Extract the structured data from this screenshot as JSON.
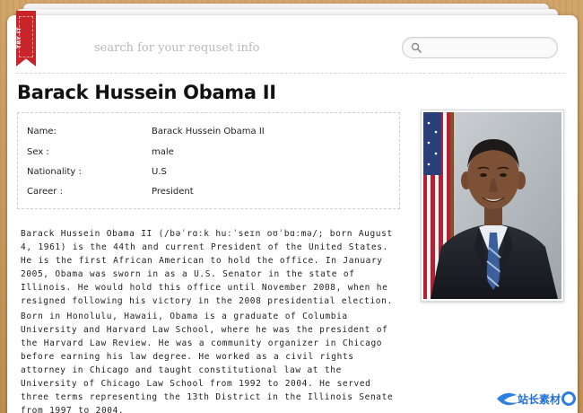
{
  "ribbon": {
    "label": "TRY IT"
  },
  "search": {
    "hint": "search for your requset info",
    "placeholder": "",
    "icon": "search-icon"
  },
  "profile": {
    "title": "Barack Hussein Obama II",
    "fields": [
      {
        "label": "Name:",
        "value": "Barack Hussein Obama II"
      },
      {
        "label": "Sex :",
        "value": "male"
      },
      {
        "label": "Nationality :",
        "value": "U.S"
      },
      {
        "label": "Career :",
        "value": "President"
      }
    ],
    "photo_alt": "portrait-photo"
  },
  "bio": {
    "paragraph1": "Barack Hussein Obama II (/bəˈrɑːk huːˈseɪn oʊˈbɑːmə/; born August 4, 1961) is the 44th and current President of the United States. He is the first African American to hold the office. In January 2005, Obama was sworn in as a U.S. Senator in the state of Illinois. He would hold this office until November 2008, when he resigned following his victory in the 2008 presidential election.",
    "paragraph2": "Born in Honolulu, Hawaii, Obama is a graduate of Columbia University and Harvard Law School, where he was the president of the Harvard Law Review. He was a community organizer in Chicago before earning his law degree. He worked as a civil rights attorney in Chicago and taught constitutional law at the University of Chicago Law School from 1992 to 2004. He served three terms representing the 13th District in the Illinois Senate from 1997 to 2004."
  },
  "watermark": {
    "text": "站长素材"
  },
  "colors": {
    "ribbon": "#c8252b",
    "background_wood": "#c89a5c",
    "paper": "#ffffff",
    "hint_text": "#b9b9b9",
    "watermark": "#1f6fd6"
  }
}
